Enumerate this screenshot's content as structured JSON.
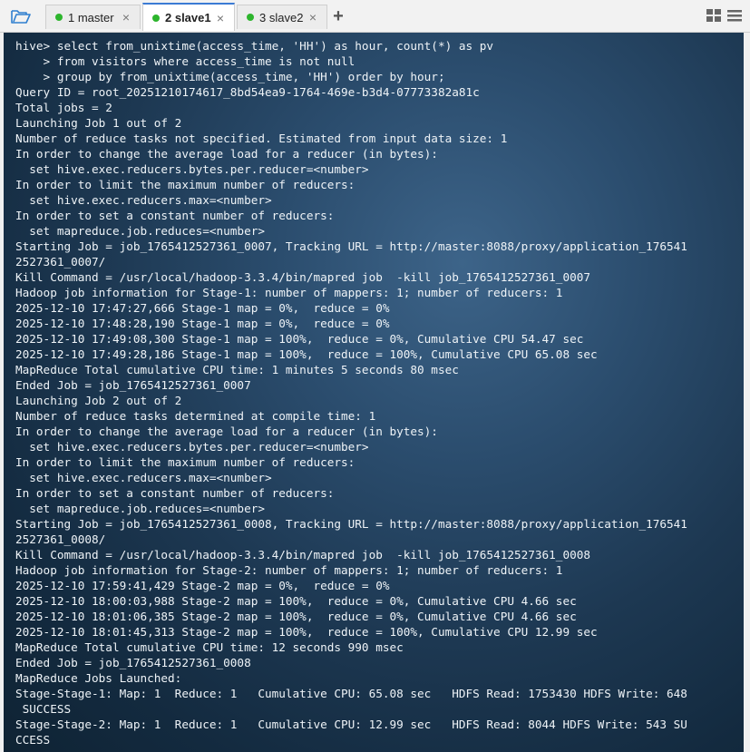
{
  "tabs": [
    {
      "label": "1 master",
      "status_color": "#2db52d"
    },
    {
      "label": "2 slave1",
      "status_color": "#2db52d",
      "active": true
    },
    {
      "label": "3 slave2",
      "status_color": "#2db52d"
    }
  ],
  "toolbar": {
    "folder_icon": "folder-open-icon",
    "new_tab_label": "+",
    "close_glyph": "×"
  },
  "terminal": {
    "lines": [
      "hive> select from_unixtime(access_time, 'HH') as hour, count(*) as pv",
      "    > from visitors where access_time is not null",
      "    > group by from_unixtime(access_time, 'HH') order by hour;",
      "Query ID = root_20251210174617_8bd54ea9-1764-469e-b3d4-07773382a81c",
      "Total jobs = 2",
      "Launching Job 1 out of 2",
      "Number of reduce tasks not specified. Estimated from input data size: 1",
      "In order to change the average load for a reducer (in bytes):",
      "  set hive.exec.reducers.bytes.per.reducer=<number>",
      "In order to limit the maximum number of reducers:",
      "  set hive.exec.reducers.max=<number>",
      "In order to set a constant number of reducers:",
      "  set mapreduce.job.reduces=<number>",
      "Starting Job = job_1765412527361_0007, Tracking URL = http://master:8088/proxy/application_176541",
      "2527361_0007/",
      "Kill Command = /usr/local/hadoop-3.3.4/bin/mapred job  -kill job_1765412527361_0007",
      "Hadoop job information for Stage-1: number of mappers: 1; number of reducers: 1",
      "2025-12-10 17:47:27,666 Stage-1 map = 0%,  reduce = 0%",
      "2025-12-10 17:48:28,190 Stage-1 map = 0%,  reduce = 0%",
      "2025-12-10 17:49:08,300 Stage-1 map = 100%,  reduce = 0%, Cumulative CPU 54.47 sec",
      "2025-12-10 17:49:28,186 Stage-1 map = 100%,  reduce = 100%, Cumulative CPU 65.08 sec",
      "MapReduce Total cumulative CPU time: 1 minutes 5 seconds 80 msec",
      "Ended Job = job_1765412527361_0007",
      "Launching Job 2 out of 2",
      "Number of reduce tasks determined at compile time: 1",
      "In order to change the average load for a reducer (in bytes):",
      "  set hive.exec.reducers.bytes.per.reducer=<number>",
      "In order to limit the maximum number of reducers:",
      "  set hive.exec.reducers.max=<number>",
      "In order to set a constant number of reducers:",
      "  set mapreduce.job.reduces=<number>",
      "Starting Job = job_1765412527361_0008, Tracking URL = http://master:8088/proxy/application_176541",
      "2527361_0008/",
      "Kill Command = /usr/local/hadoop-3.3.4/bin/mapred job  -kill job_1765412527361_0008",
      "Hadoop job information for Stage-2: number of mappers: 1; number of reducers: 1",
      "2025-12-10 17:59:41,429 Stage-2 map = 0%,  reduce = 0%",
      "2025-12-10 18:00:03,988 Stage-2 map = 100%,  reduce = 0%, Cumulative CPU 4.66 sec",
      "2025-12-10 18:01:06,385 Stage-2 map = 100%,  reduce = 0%, Cumulative CPU 4.66 sec",
      "2025-12-10 18:01:45,313 Stage-2 map = 100%,  reduce = 100%, Cumulative CPU 12.99 sec",
      "MapReduce Total cumulative CPU time: 12 seconds 990 msec",
      "Ended Job = job_1765412527361_0008",
      "MapReduce Jobs Launched:",
      "Stage-Stage-1: Map: 1  Reduce: 1   Cumulative CPU: 65.08 sec   HDFS Read: 1753430 HDFS Write: 648",
      " SUCCESS",
      "Stage-Stage-2: Map: 1  Reduce: 1   Cumulative CPU: 12.99 sec   HDFS Read: 8044 HDFS Write: 543 SU",
      "CCESS"
    ]
  }
}
